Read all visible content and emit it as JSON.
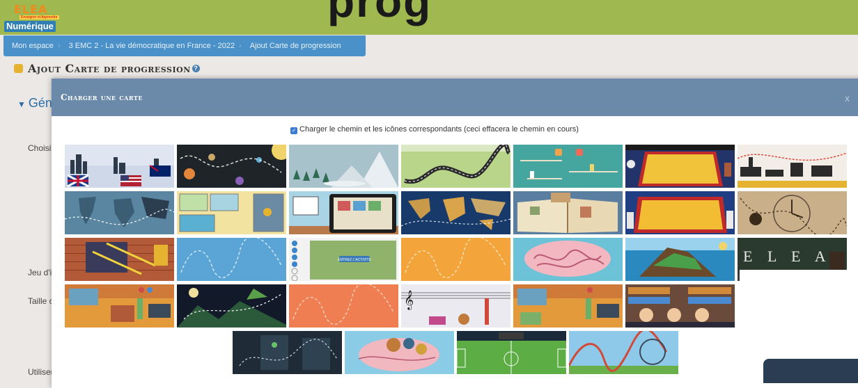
{
  "app": {
    "logo_top": "ELEA",
    "logo_tag": "Enseigner et Apprendre",
    "logo_bottom": "Numérique",
    "partial_title": "prog"
  },
  "breadcrumb": [
    "Mon espace",
    "3 EMC 2 - La vie démocratique en France - 2022",
    "Ajout Carte de progression"
  ],
  "page": {
    "title": "Ajout Carte de progression",
    "help_icon": "question-icon",
    "section": "Gén",
    "labels": [
      "Choisi",
      "Jeu d'i",
      "Taille c",
      "Utiliser"
    ]
  },
  "modal": {
    "title": "Charger une carte",
    "close": "x",
    "checkbox_label": "Charger le chemin et les icônes correspondants (ceci effacera le chemin en cours)",
    "checkbox_checked": true
  },
  "maps": [
    {
      "name": "map-cities-flags"
    },
    {
      "name": "map-space-planets"
    },
    {
      "name": "map-winter-mountain"
    },
    {
      "name": "map-road-hills"
    },
    {
      "name": "map-lab-shelves"
    },
    {
      "name": "map-stage-astronaut"
    },
    {
      "name": "map-london-skyline"
    },
    {
      "name": "map-world-dark"
    },
    {
      "name": "map-school-plan"
    },
    {
      "name": "map-tablet-desk"
    },
    {
      "name": "map-world-blue"
    },
    {
      "name": "map-open-book"
    },
    {
      "name": "map-stage-red"
    },
    {
      "name": "map-clock-parchment"
    },
    {
      "name": "map-brick-wall"
    },
    {
      "name": "map-blue-path"
    },
    {
      "name": "map-progress-green",
      "text": "ENTREZ L'ACTIVITE"
    },
    {
      "name": "map-orange-path"
    },
    {
      "name": "map-brain"
    },
    {
      "name": "map-island"
    },
    {
      "name": "map-elea-board",
      "text": "E L E A"
    },
    {
      "name": "map-classroom"
    },
    {
      "name": "map-night-witch"
    },
    {
      "name": "map-red-path"
    },
    {
      "name": "map-music"
    },
    {
      "name": "map-classroom-2"
    },
    {
      "name": "map-library"
    },
    {
      "name": "map-cyber"
    },
    {
      "name": "map-brain-gears"
    },
    {
      "name": "map-football"
    },
    {
      "name": "map-rollercoaster"
    }
  ]
}
